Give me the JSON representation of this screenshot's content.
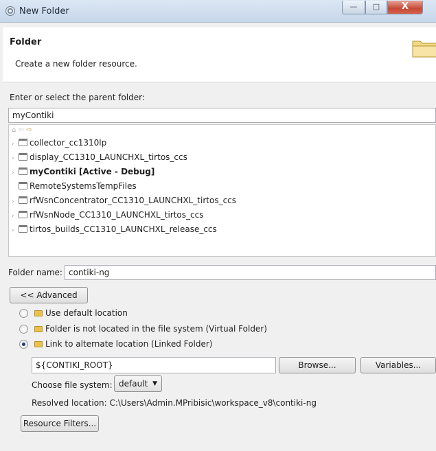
{
  "window": {
    "title": "New Folder",
    "minimize_glyph": "—",
    "maximize_glyph": "□",
    "close_glyph": "X"
  },
  "banner": {
    "title": "Folder",
    "description": "Create a new folder resource."
  },
  "parent": {
    "label": "Enter or select the parent folder:",
    "value": "myContiki"
  },
  "tree": {
    "items": [
      {
        "label": "collector_cc1310lp",
        "bold": false
      },
      {
        "label": "display_CC1310_LAUNCHXL_tirtos_ccs",
        "bold": false
      },
      {
        "label": "myContiki  [Active - Debug]",
        "bold": true
      },
      {
        "label": "RemoteSystemsTempFiles",
        "bold": false
      },
      {
        "label": "rfWsnConcentrator_CC1310_LAUNCHXL_tirtos_ccs",
        "bold": false
      },
      {
        "label": "rfWsnNode_CC1310_LAUNCHXL_tirtos_ccs",
        "bold": false
      },
      {
        "label": "tirtos_builds_CC1310_LAUNCHXL_release_ccs",
        "bold": false
      }
    ]
  },
  "folder_name": {
    "label": "Folder name:",
    "value": "contiki-ng"
  },
  "advanced_button": "<< Advanced",
  "options": {
    "default_location": "Use default location",
    "virtual_folder": "Folder is not located in the file system (Virtual Folder)",
    "linked_folder": "Link to alternate location (Linked Folder)",
    "selected": "linked_folder"
  },
  "location": {
    "value": "${CONTIKI_ROOT}",
    "browse_button": "Browse...",
    "variables_button": "Variables..."
  },
  "file_system": {
    "label": "Choose file system:",
    "selected": "default"
  },
  "resolved": {
    "text": "Resolved location: C:\\Users\\Admin.MPribisic\\workspace_v8\\contiki-ng"
  },
  "resource_filters_button": "Resource Filters...",
  "colors": {
    "titlebar": "#c6d6ea",
    "close": "#c44a36",
    "dialog_bg": "#f0f0f0"
  }
}
